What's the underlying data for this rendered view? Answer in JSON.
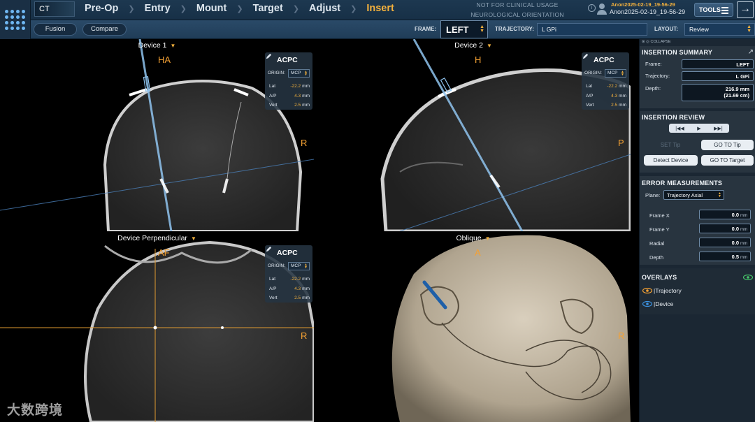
{
  "topbar": {
    "modality": "CT",
    "steps": [
      "Pre-Op",
      "Entry",
      "Mount",
      "Target",
      "Adjust",
      "Insert"
    ],
    "active_step": "Insert",
    "notice_line1": "NOT FOR CLINICAL USAGE",
    "notice_line2": "NEUROLOGICAL ORIENTATION",
    "patient_top": "Anon2025-02-19_19-56-29",
    "patient_bottom": "Anon2025-02-19_19-56-29",
    "tools_label": "TOOLS"
  },
  "subbar": {
    "fusion_label": "Fusion",
    "compare_label": "Compare",
    "frame_label": "FRAME:",
    "frame_value": "LEFT",
    "trajectory_label": "TRAJECTORY:",
    "trajectory_value": "L GPi",
    "layout_label": "LAYOUT:",
    "layout_value": "Review"
  },
  "viewports": {
    "v1": {
      "title": "Device 1",
      "orient_top": "HA",
      "orient_right": "R"
    },
    "v2": {
      "title": "Device 2",
      "orient_top": "H",
      "orient_right": "P"
    },
    "v3": {
      "title": "Device Perpendicular",
      "orient_top": "AF",
      "orient_right": "R"
    },
    "v4": {
      "title": "Oblique",
      "orient_top": "A",
      "orient_right": "R"
    }
  },
  "acpc": {
    "title": "ACPC",
    "origin_label": "ORIGIN:",
    "origin_value": "MCP",
    "lat_label": "Lat",
    "lat_value": "-22.2",
    "ap_label": "A/P",
    "ap_value": "4.3",
    "vert_label": "Vert",
    "vert_value": "2.5",
    "unit": "mm"
  },
  "panel": {
    "collapse_label": "COLLAPSE",
    "summary_title": "INSERTION SUMMARY",
    "frame_label": "Frame:",
    "frame_value": "LEFT",
    "trajectory_label": "Trajectory:",
    "trajectory_value": "L GPi",
    "depth_label": "Depth:",
    "depth_mm": "216.9 mm",
    "depth_cm": "(21.69 cm)",
    "review_title": "INSERTION REVIEW",
    "set_tip_label": "SET Tip",
    "goto_tip_label": "GO TO Tip",
    "detect_device_label": "Detect Device",
    "goto_target_label": "GO TO Target",
    "error_title": "ERROR MEASUREMENTS",
    "plane_label": "Plane:",
    "plane_value": "Trajectory Axial",
    "errors": [
      {
        "label": "Frame X",
        "value": "0.0"
      },
      {
        "label": "Frame Y",
        "value": "0.0"
      },
      {
        "label": "Radial",
        "value": "0.0"
      },
      {
        "label": "Depth",
        "value": "0.5"
      }
    ],
    "err_unit": "mm",
    "overlays_title": "OVERLAYS",
    "overlay_trajectory": "Trajectory",
    "overlay_device": "Device",
    "colors": {
      "trajectory_eye": "#f4a133",
      "device_eye": "#3c92e0",
      "overlays_eye": "#46c46a"
    }
  },
  "watermark": "大数跨境"
}
